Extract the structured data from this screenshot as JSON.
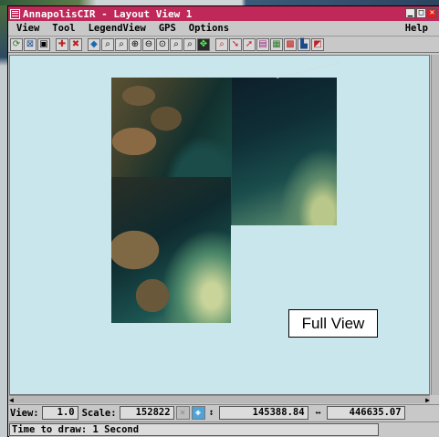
{
  "window": {
    "title": "AnnapolisCIR - Layout View 1"
  },
  "menubar": {
    "items": [
      "View",
      "Tool",
      "LegendView",
      "GPS",
      "Options"
    ],
    "help": "Help"
  },
  "toolbar": {
    "icons": [
      "redraw-icon",
      "full-extent-icon",
      "frame-icon",
      "add-layer-icon",
      "remove-layer-icon",
      "pan-icon",
      "zoom-box-icon",
      "zoom-region-icon",
      "zoom-in-icon",
      "zoom-out-icon",
      "zoom-1x-icon",
      "zoom-previous-icon",
      "zoom-next-icon",
      "select-icon",
      "inspect-icon",
      "pointer-icon",
      "edit-icon",
      "legend-icon",
      "layer-controls-icon",
      "color-icon",
      "group-icon",
      "gps-icon"
    ]
  },
  "canvas": {
    "annotation": "Full View",
    "background": "#c8e6ec"
  },
  "status": {
    "view_label": "View:",
    "view_value": "1.0",
    "scale_label": "Scale:",
    "scale_value": "152822",
    "x_coord": "145388.84",
    "y_coord": "446635.07",
    "message": "Time to draw: 1 Second"
  },
  "colors": {
    "titlebar": "#c0285a",
    "chrome": "#c8c8c8"
  }
}
